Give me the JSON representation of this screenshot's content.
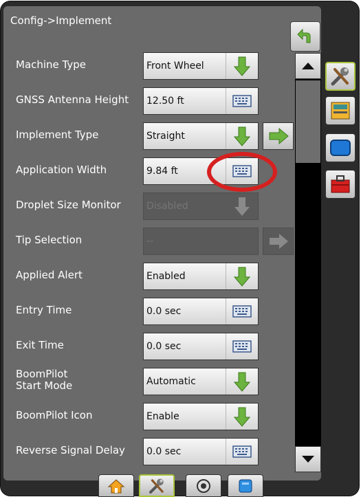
{
  "title": "Config->Implement",
  "rows": [
    {
      "label": "Machine Type",
      "value": "Front Wheel"
    },
    {
      "label": "GNSS Antenna Height",
      "value": "12.50 ft"
    },
    {
      "label": "Implement Type",
      "value": "Straight"
    },
    {
      "label": "Application Width",
      "value": "9.84 ft"
    },
    {
      "label": "Droplet Size Monitor",
      "value": "Disabled"
    },
    {
      "label": "Tip Selection",
      "value": "--"
    },
    {
      "label": "Applied Alert",
      "value": "Enabled"
    },
    {
      "label": "Entry Time",
      "value": "0.0 sec"
    },
    {
      "label": "Exit Time",
      "value": "0.0 sec"
    },
    {
      "label": "BoomPilot\nStart Mode",
      "value": "Automatic"
    },
    {
      "label": "BoomPilot Icon",
      "value": "Enable"
    },
    {
      "label": "Reverse Signal Delay",
      "value": "0.0 sec"
    }
  ],
  "right_tabs": [
    "tools-icon",
    "console-icon",
    "display-icon",
    "toolbox-icon"
  ],
  "bottom_tabs": [
    "home-icon",
    "tools-icon",
    "guidance-icon",
    "data-icon"
  ],
  "colors": {
    "accent_green": "#6cb33f",
    "highlight_red": "#d62020",
    "active_outline": "#a9c63b"
  }
}
